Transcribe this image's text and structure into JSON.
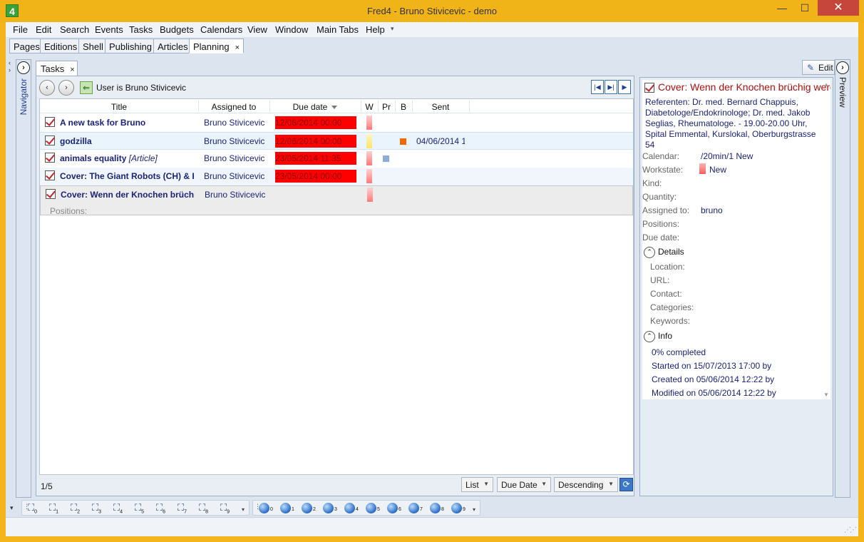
{
  "window": {
    "title": "Fred4 - Bruno Stivicevic - demo",
    "app_icon": "4",
    "min": "—",
    "max": "☐",
    "close": "✕"
  },
  "menu": [
    "File",
    "Edit",
    "Search",
    "Events",
    "Tasks",
    "Budgets",
    "Calendars",
    "View",
    "Window",
    "Main Tabs",
    "Help"
  ],
  "main_tabs": [
    "Pages",
    "Editions",
    "Shell",
    "Publishing",
    "Articles",
    "Planning"
  ],
  "active_main_tab": "Planning",
  "navigator": {
    "label": "Navigator"
  },
  "preview_strip": {
    "label": "Preview"
  },
  "tasks": {
    "tab_label": "Tasks",
    "filter_text": "User is Bruno Stivicevic",
    "columns": {
      "title": "Title",
      "assigned": "Assigned to",
      "due": "Due date",
      "w": "W",
      "pr": "Pr",
      "b": "B",
      "sent": "Sent"
    },
    "rows": [
      {
        "title": "A new task for Bruno",
        "tag": "",
        "assigned": "Bruno Stivicevic",
        "due": "12/06/2014 00:00",
        "sent": ""
      },
      {
        "title": "godzilla",
        "tag": "",
        "assigned": "Bruno Stivicevic",
        "due": "12/06/2014 00:00",
        "sent": "04/06/2014 1"
      },
      {
        "title": "animals equality",
        "tag": "[Article]",
        "assigned": "Bruno Stivicevic",
        "due": "23/05/2014 11:35",
        "sent": ""
      },
      {
        "title": "Cover: The Giant Robots (CH) & Re",
        "tag": "",
        "assigned": "Bruno Stivicevic",
        "due": "23/05/2014 00:00",
        "sent": ""
      },
      {
        "title": "Cover: Wenn der Knochen brüchig",
        "tag": "",
        "assigned": "Bruno Stivicevic",
        "due": "",
        "sent": ""
      }
    ],
    "positions_label": "Positions:",
    "count": "1/5",
    "view_mode": "List",
    "sort_field": "Due Date",
    "sort_order": "Descending"
  },
  "preview": {
    "edit_label": "Edit",
    "title": "Cover: Wenn der Knochen brüchig werden",
    "description": "Referenten: Dr. med. Bernard Chappuis, Diabetologe/Endokrinologe; Dr. med. Jakob Seglias, Rheumatologe.  - 19.00-20.00 Uhr, Spital Emmental, Kurslokal, Oberburgstrasse 54",
    "fields": {
      "calendar_label": "Calendar:",
      "calendar_value": "/20min/1 New",
      "workstate_label": "Workstate:",
      "workstate_value": "New",
      "kind_label": "Kind:",
      "quantity_label": "Quantity:",
      "assigned_label": "Assigned to:",
      "assigned_value": "bruno",
      "positions_label": "Positions:",
      "due_label": "Due date:"
    },
    "details": {
      "header": "Details",
      "location": "Location:",
      "url": "URL:",
      "contact": "Contact:",
      "categories": "Categories:",
      "keywords": "Keywords:"
    },
    "info": {
      "header": "Info",
      "completed": "0% completed",
      "started": "Started on 15/07/2013 17:00 by",
      "created": "Created on 05/06/2014 12:22 by",
      "modified": "Modified on 05/06/2014 12:22 by"
    }
  },
  "bottom_toolbar": {
    "binocular_slots": [
      "0",
      "1",
      "2",
      "3",
      "4",
      "5",
      "6",
      "7",
      "8",
      "9"
    ],
    "globe_slots": [
      "0",
      "1",
      "2",
      "3",
      "4",
      "5",
      "6",
      "7",
      "8",
      "9"
    ]
  },
  "colors": {
    "overdue": "#ff0000",
    "title_link": "#1b237a",
    "preview_title": "#b00d0d",
    "frame": "#f0b419"
  }
}
